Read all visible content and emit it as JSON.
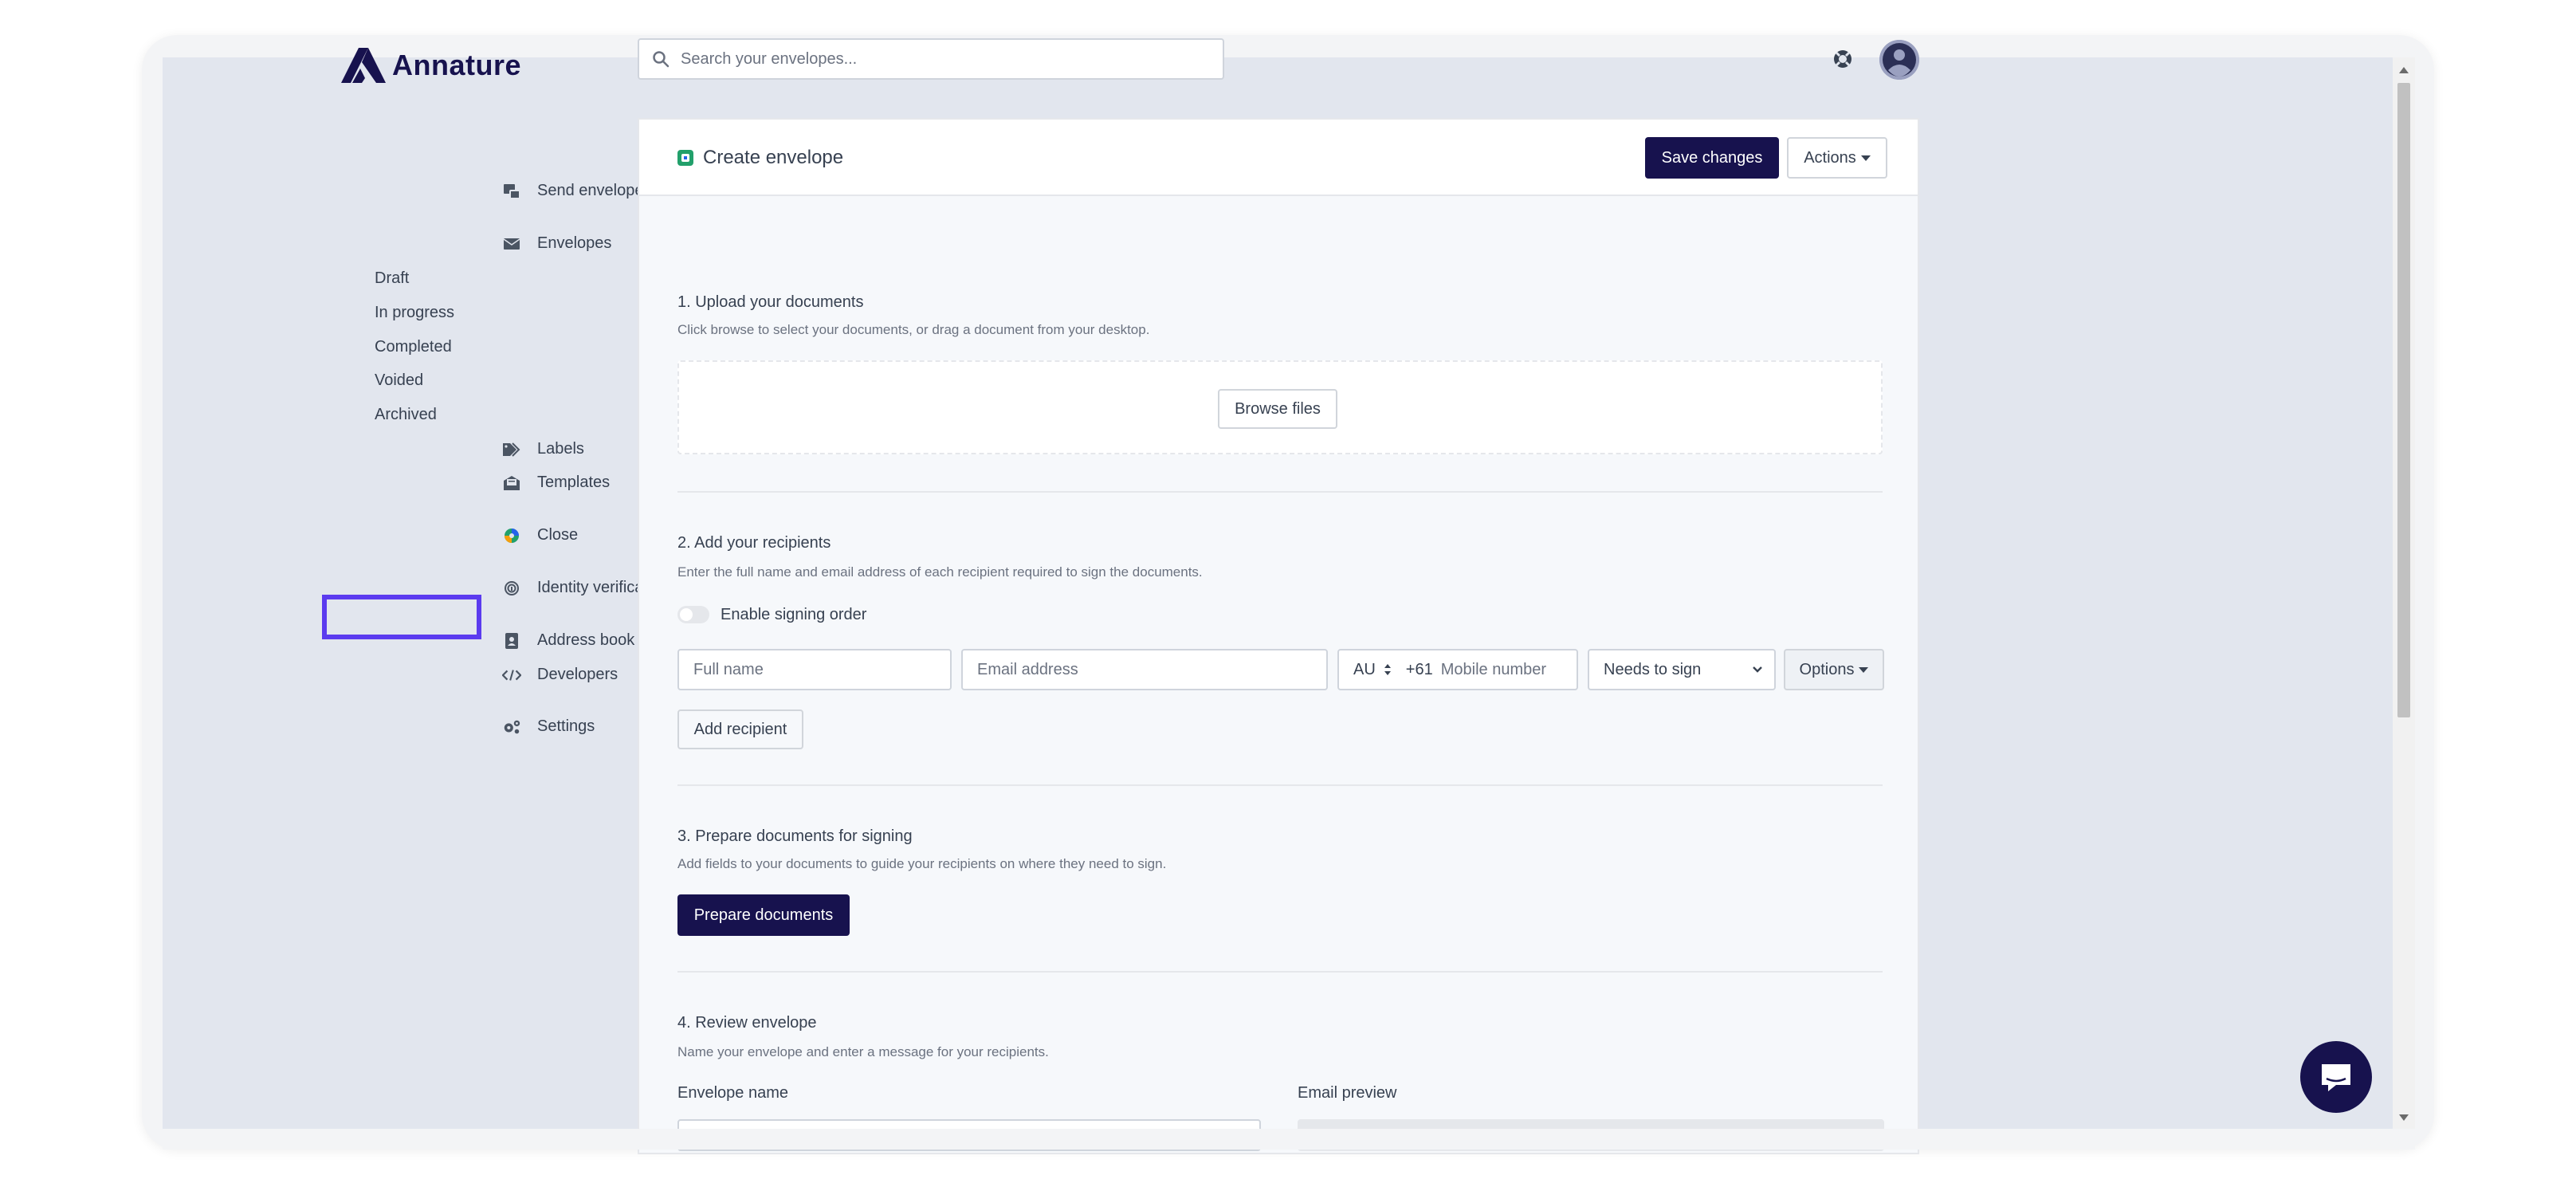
{
  "app": {
    "name": "Annature"
  },
  "search": {
    "placeholder": "Search your envelopes..."
  },
  "sidebar": {
    "send_envelope": "Send envelope",
    "envelopes": "Envelopes",
    "envelope_items": [
      "Draft",
      "In progress",
      "Completed",
      "Voided",
      "Archived"
    ],
    "labels": "Labels",
    "templates": "Templates",
    "close": "Close",
    "identity_verification": "Identity verification",
    "address_book": "Address book",
    "developers": "Developers",
    "settings": "Settings"
  },
  "card": {
    "title": "Create envelope",
    "save_changes": "Save changes",
    "actions": "Actions"
  },
  "section1": {
    "title": "1. Upload your documents",
    "desc": "Click browse to select your documents, or drag a document from your desktop.",
    "browse": "Browse files"
  },
  "section2": {
    "title": "2. Add your recipients",
    "desc": "Enter the full name and email address of each recipient required to sign the documents.",
    "signing_order": "Enable signing order",
    "full_name_placeholder": "Full name",
    "email_placeholder": "Email address",
    "country": "AU",
    "dial_code": "+61",
    "mobile_placeholder": "Mobile number",
    "role": "Needs to sign",
    "options": "Options",
    "add_recipient": "Add recipient"
  },
  "section3": {
    "title": "3. Prepare documents for signing",
    "desc": "Add fields to your documents to guide your recipients on where they need to sign.",
    "button": "Prepare documents"
  },
  "section4": {
    "title": "4. Review envelope",
    "desc": "Name your envelope and enter a message for your recipients.",
    "envelope_name": "Envelope name",
    "email_preview": "Email preview"
  },
  "icons": {
    "logo": "annature-logo-icon",
    "search": "search-icon",
    "help": "lifebuoy-icon",
    "avatar": "user-avatar-icon",
    "chat": "chat-icon",
    "arrow": "pointer-arrow-icon"
  },
  "colors": {
    "brand": "#17124e",
    "highlight": "#5b3bef",
    "background": "#e2e6ee"
  }
}
